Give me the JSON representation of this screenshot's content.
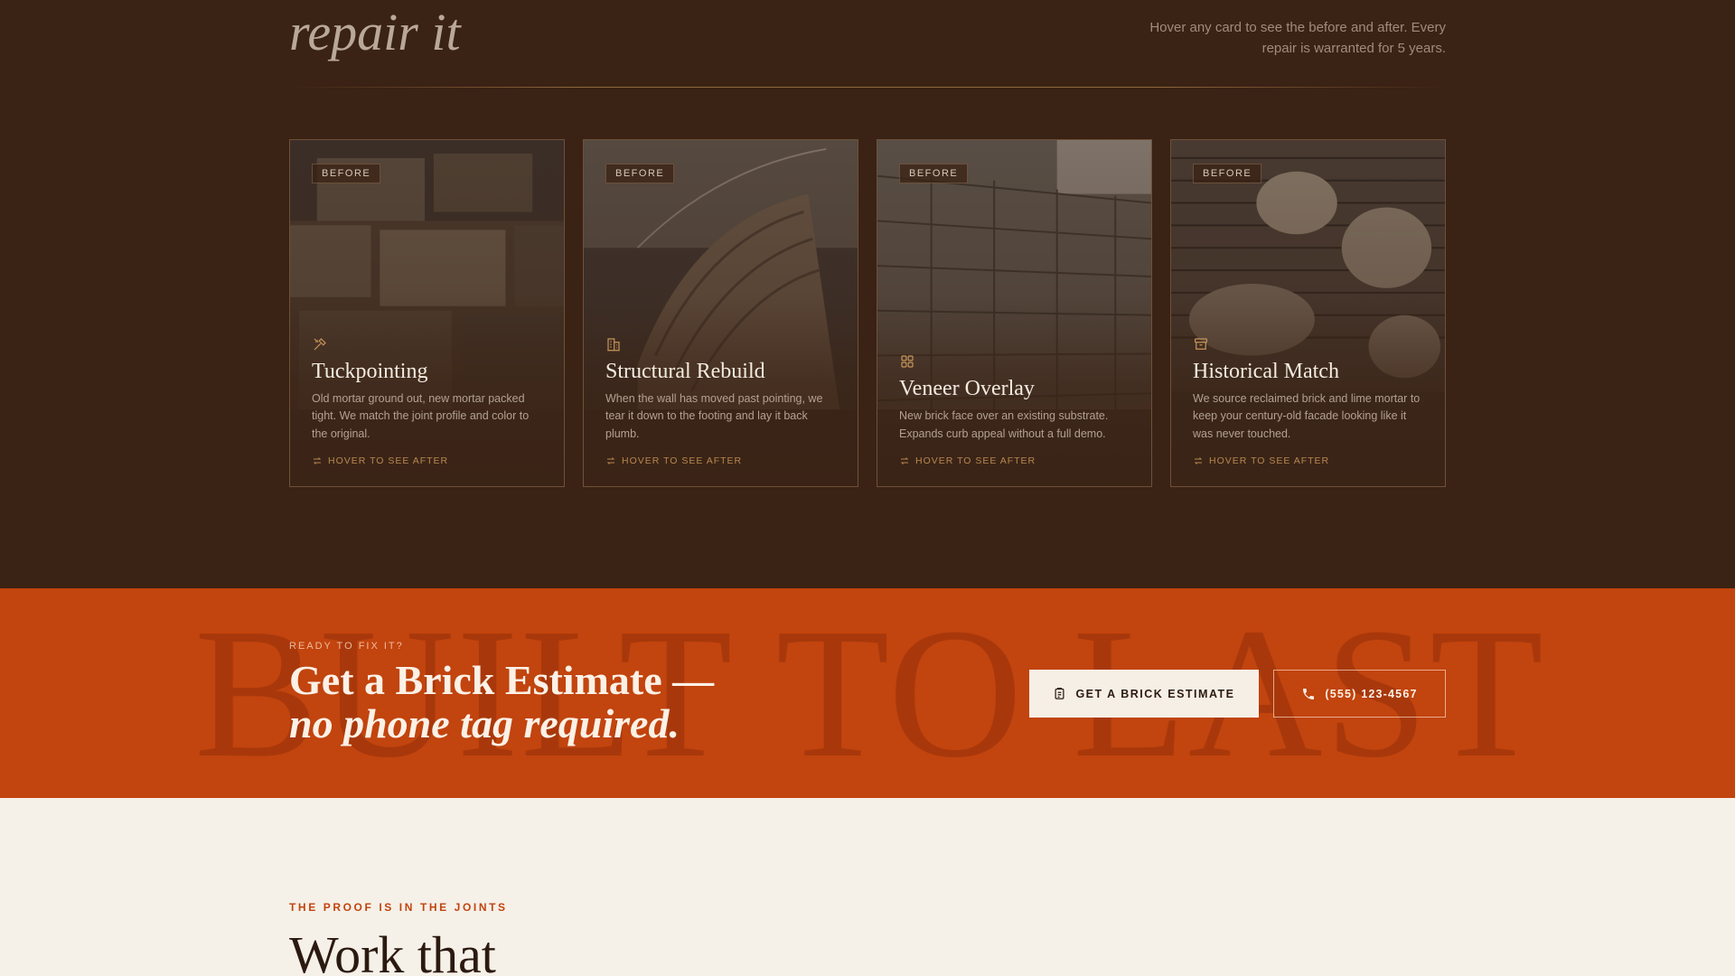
{
  "services": {
    "title": "repair it",
    "description": "Hover any card to see the before and after. Every repair is warranted for 5 years.",
    "cards": [
      {
        "badge": "BEFORE",
        "icon": "tools-icon",
        "title": "Tuckpointing",
        "text": "Old mortar ground out, new mortar packed tight. We match the joint profile and color to the original.",
        "hint": "HOVER TO SEE AFTER"
      },
      {
        "badge": "BEFORE",
        "icon": "building-icon",
        "title": "Structural Rebuild",
        "text": "When the wall has moved past pointing, we tear it down to the footing and lay it back plumb.",
        "hint": "HOVER TO SEE AFTER"
      },
      {
        "badge": "BEFORE",
        "icon": "grid-icon",
        "title": "Veneer Overlay",
        "text": "New brick face over an existing substrate. Expands curb appeal without a full demo.",
        "hint": "HOVER TO SEE AFTER"
      },
      {
        "badge": "BEFORE",
        "icon": "archive-icon",
        "title": "Historical Match",
        "text": "We source reclaimed brick and lime mortar to keep your century-old facade looking like it was never touched.",
        "hint": "HOVER TO SEE AFTER"
      }
    ]
  },
  "cta": {
    "watermark": "BUILT TO LAST",
    "eyebrow": "READY TO FIX IT?",
    "headline_line1": "Get a Brick Estimate —",
    "headline_line2": "no phone tag required.",
    "estimate_button": "GET A BRICK ESTIMATE",
    "phone_button": "(555) 123-4567"
  },
  "proof": {
    "eyebrow": "THE PROOF IS IN THE JOINTS",
    "title": "Work that"
  },
  "colors": {
    "dark_brown": "#3a2214",
    "rust": "#c2440e",
    "cream": "#f5f0e8",
    "gold": "#b8874f"
  }
}
